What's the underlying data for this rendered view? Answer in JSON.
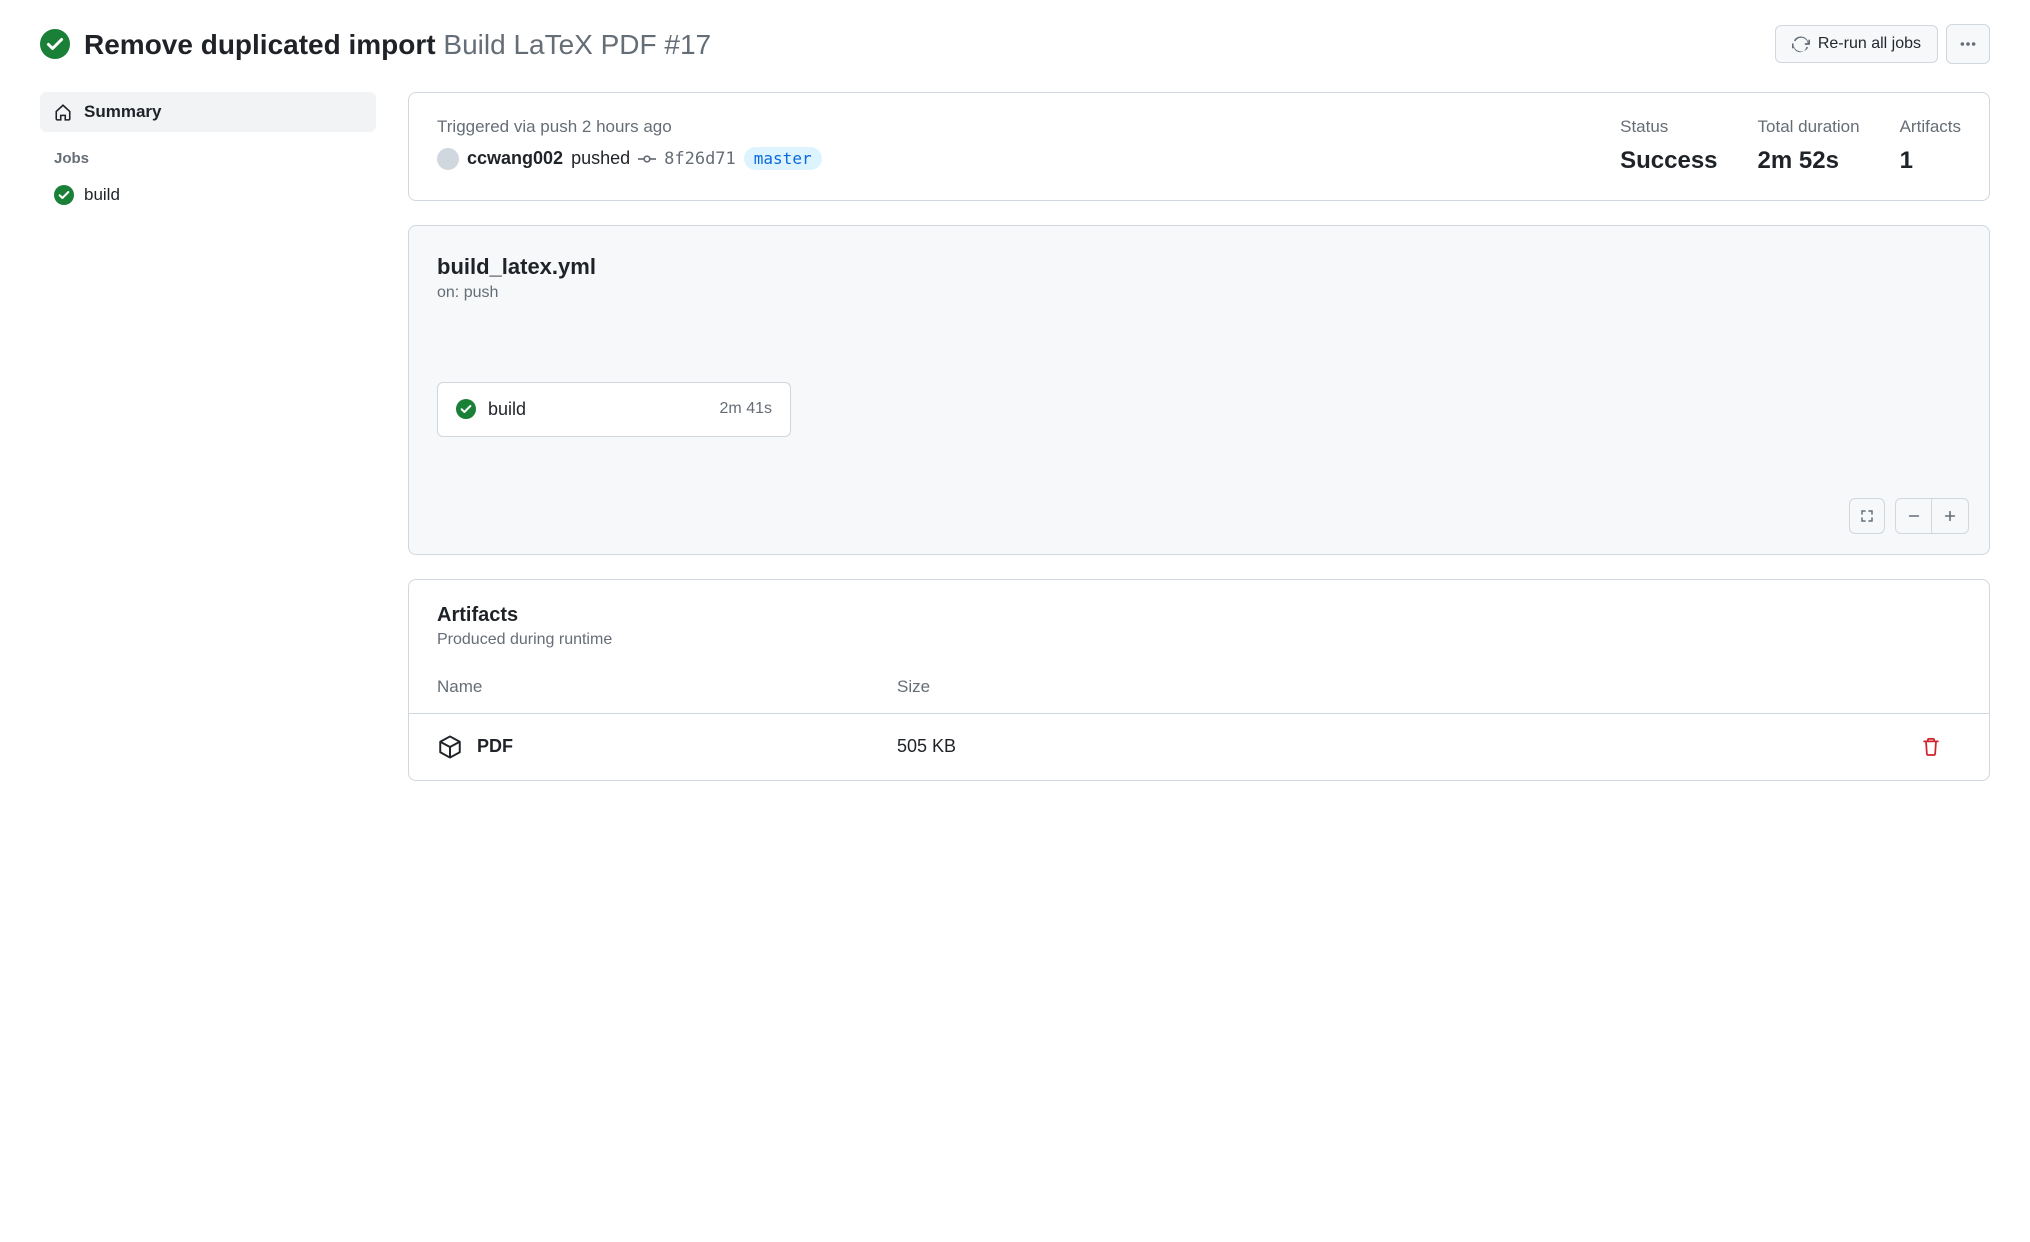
{
  "header": {
    "title": "Remove duplicated import",
    "workflow_run": "Build LaTeX PDF #17",
    "rerun_label": "Re-run all jobs"
  },
  "sidebar": {
    "summary_label": "Summary",
    "jobs_heading": "Jobs",
    "jobs": [
      {
        "name": "build"
      }
    ]
  },
  "trigger": {
    "text": "Triggered via push 2 hours ago",
    "actor": "ccwang002",
    "action": "pushed",
    "sha": "8f26d71",
    "branch": "master",
    "status_label": "Status",
    "status_value": "Success",
    "duration_label": "Total duration",
    "duration_value": "2m 52s",
    "artifacts_label": "Artifacts",
    "artifacts_value": "1"
  },
  "workflow": {
    "file": "build_latex.yml",
    "on": "on: push",
    "job_name": "build",
    "job_time": "2m 41s"
  },
  "artifacts": {
    "title": "Artifacts",
    "subtitle": "Produced during runtime",
    "col_name": "Name",
    "col_size": "Size",
    "rows": [
      {
        "name": "PDF",
        "size": "505 KB"
      }
    ]
  }
}
